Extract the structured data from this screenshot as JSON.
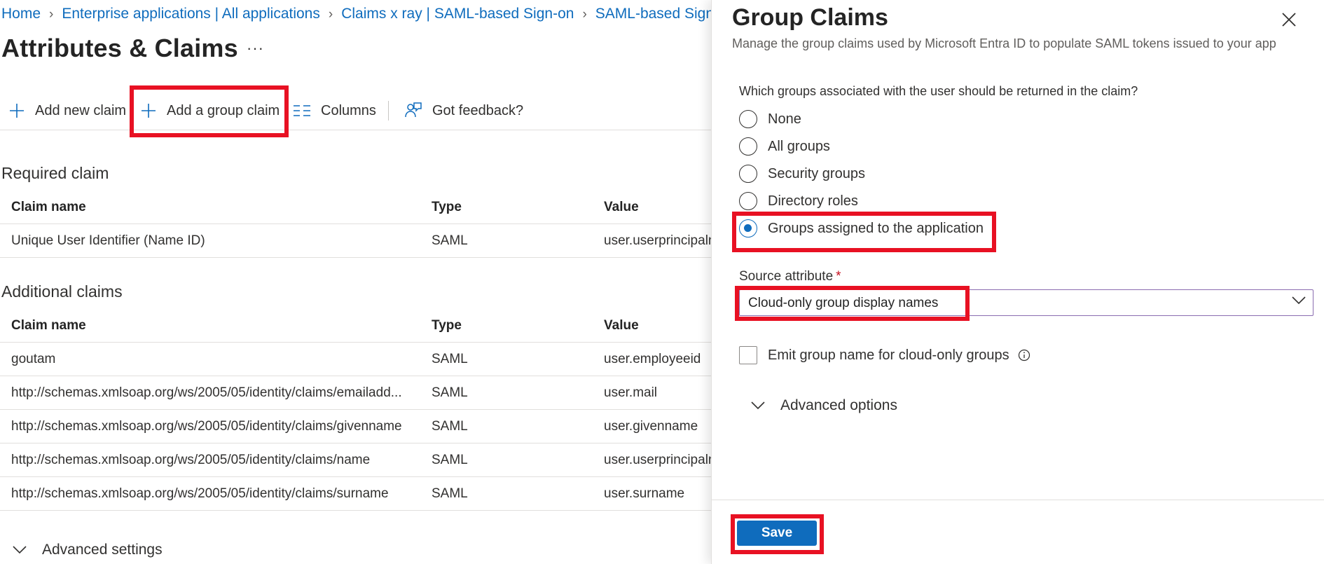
{
  "breadcrumb": [
    {
      "label": "Home"
    },
    {
      "label": "Enterprise applications | All applications"
    },
    {
      "label": "Claims x ray | SAML-based Sign-on"
    },
    {
      "label": "SAML-based Sign-on"
    }
  ],
  "page": {
    "title": "Attributes & Claims",
    "more_label": "···"
  },
  "toolbar": {
    "add_new_claim": "Add new claim",
    "add_group_claim": "Add a group claim",
    "columns": "Columns",
    "feedback": "Got feedback?"
  },
  "required": {
    "title": "Required claim",
    "headers": {
      "name": "Claim name",
      "type": "Type",
      "value": "Value"
    },
    "rows": [
      {
        "name": "Unique User Identifier (Name ID)",
        "type": "SAML",
        "value": "user.userprincipalname"
      }
    ]
  },
  "additional": {
    "title": "Additional claims",
    "headers": {
      "name": "Claim name",
      "type": "Type",
      "value": "Value"
    },
    "rows": [
      {
        "name": "goutam",
        "type": "SAML",
        "value": "user.employeeid"
      },
      {
        "name": "http://schemas.xmlsoap.org/ws/2005/05/identity/claims/emailadd...",
        "type": "SAML",
        "value": "user.mail"
      },
      {
        "name": "http://schemas.xmlsoap.org/ws/2005/05/identity/claims/givenname",
        "type": "SAML",
        "value": "user.givenname"
      },
      {
        "name": "http://schemas.xmlsoap.org/ws/2005/05/identity/claims/name",
        "type": "SAML",
        "value": "user.userprincipalname"
      },
      {
        "name": "http://schemas.xmlsoap.org/ws/2005/05/identity/claims/surname",
        "type": "SAML",
        "value": "user.surname"
      }
    ]
  },
  "advanced_settings": "Advanced settings",
  "panel": {
    "title": "Group Claims",
    "subtitle": "Manage the group claims used by Microsoft Entra ID to populate SAML tokens issued to your app",
    "question": "Which groups associated with the user should be returned in the claim?",
    "radio_options": [
      {
        "label": "None",
        "checked": false
      },
      {
        "label": "All groups",
        "checked": false
      },
      {
        "label": "Security groups",
        "checked": false
      },
      {
        "label": "Directory roles",
        "checked": false
      },
      {
        "label": "Groups assigned to the application",
        "checked": true
      }
    ],
    "source_attribute_label": "Source attribute",
    "required_marker": "*",
    "source_attribute_value": "Cloud-only group display names",
    "emit_checkbox_label": "Emit group name for cloud-only groups",
    "emit_checkbox_checked": false,
    "advanced_options": "Advanced options",
    "save_label": "Save"
  },
  "colors": {
    "accent": "#0f6cbd",
    "highlight": "#e81123",
    "required": "#c50f1f"
  },
  "icons": [
    "chevron-right-icon",
    "plus-icon",
    "columns-icon",
    "feedback-icon",
    "chevron-down-icon",
    "close-icon",
    "info-icon"
  ]
}
